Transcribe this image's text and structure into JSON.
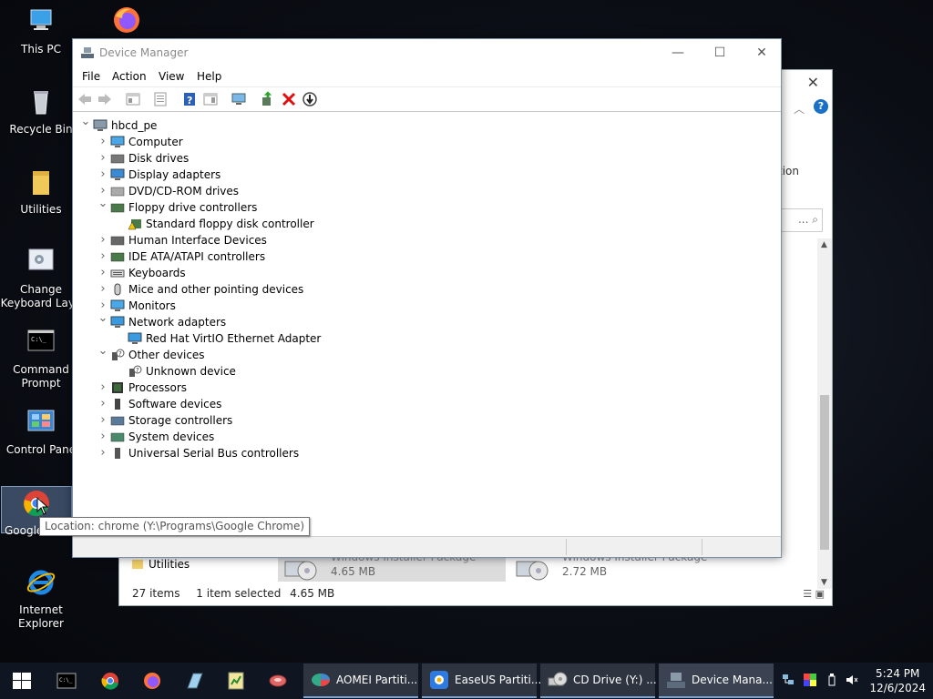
{
  "desktop": {
    "icons": [
      {
        "label": "This PC"
      },
      {
        "label": "Recycle Bin"
      },
      {
        "label": "Utilities"
      },
      {
        "label": "Change Keyboard Layo"
      },
      {
        "label": "Command Prompt"
      },
      {
        "label": "Control Pane"
      },
      {
        "label": "Google"
      },
      {
        "label": "Internet Explorer"
      }
    ]
  },
  "tooltip": "Location: chrome (Y:\\Programs\\Google Chrome)",
  "explorer": {
    "ribbon_fragment": "tion",
    "search_fragment": "...",
    "items_count": "27 items",
    "selection": "1 item selected",
    "selection_size": "4.65 MB",
    "folder_label": "Utilities",
    "files": [
      {
        "type": "Windows Installer Package",
        "size": "4.65 MB"
      },
      {
        "type": "Windows Installer Package",
        "size": "2.72 MB"
      }
    ]
  },
  "device_manager": {
    "title": "Device Manager",
    "menu": [
      "File",
      "Action",
      "View",
      "Help"
    ],
    "tree": [
      {
        "label": "hbcd_pe",
        "level": 0,
        "expanded": true,
        "icon": "computer-icon"
      },
      {
        "label": "Computer",
        "level": 1,
        "expanded": false,
        "icon": "monitor-icon"
      },
      {
        "label": "Disk drives",
        "level": 1,
        "expanded": false,
        "icon": "disk-icon"
      },
      {
        "label": "Display adapters",
        "level": 1,
        "expanded": false,
        "icon": "display-adapter-icon"
      },
      {
        "label": "DVD/CD-ROM drives",
        "level": 1,
        "expanded": false,
        "icon": "dvd-icon"
      },
      {
        "label": "Floppy drive controllers",
        "level": 1,
        "expanded": true,
        "icon": "controller-icon"
      },
      {
        "label": "Standard floppy disk controller",
        "level": 2,
        "expanded": null,
        "icon": "warning-controller-icon"
      },
      {
        "label": "Human Interface Devices",
        "level": 1,
        "expanded": false,
        "icon": "hid-icon"
      },
      {
        "label": "IDE ATA/ATAPI controllers",
        "level": 1,
        "expanded": false,
        "icon": "controller-icon"
      },
      {
        "label": "Keyboards",
        "level": 1,
        "expanded": false,
        "icon": "keyboard-icon"
      },
      {
        "label": "Mice and other pointing devices",
        "level": 1,
        "expanded": false,
        "icon": "mouse-icon"
      },
      {
        "label": "Monitors",
        "level": 1,
        "expanded": false,
        "icon": "monitor-icon"
      },
      {
        "label": "Network adapters",
        "level": 1,
        "expanded": true,
        "icon": "network-icon"
      },
      {
        "label": "Red Hat VirtIO Ethernet Adapter",
        "level": 2,
        "expanded": null,
        "icon": "network-icon"
      },
      {
        "label": "Other devices",
        "level": 1,
        "expanded": true,
        "icon": "unknown-device-icon"
      },
      {
        "label": "Unknown device",
        "level": 2,
        "expanded": null,
        "icon": "unknown-device-icon"
      },
      {
        "label": "Processors",
        "level": 1,
        "expanded": false,
        "icon": "processor-icon"
      },
      {
        "label": "Software devices",
        "level": 1,
        "expanded": false,
        "icon": "software-device-icon"
      },
      {
        "label": "Storage controllers",
        "level": 1,
        "expanded": false,
        "icon": "storage-icon"
      },
      {
        "label": "System devices",
        "level": 1,
        "expanded": false,
        "icon": "system-icon"
      },
      {
        "label": "Universal Serial Bus controllers",
        "level": 1,
        "expanded": false,
        "icon": "usb-icon"
      }
    ]
  },
  "taskbar": {
    "apps": [
      {
        "label": "AOMEI Partiti..."
      },
      {
        "label": "EaseUS Partiti..."
      },
      {
        "label": "CD Drive (Y:) ..."
      },
      {
        "label": "Device Mana..."
      }
    ],
    "time": "5:24 PM",
    "date": "12/6/2024"
  },
  "colors": {
    "accent": "#1a6fc6",
    "taskbar": "#101522"
  }
}
